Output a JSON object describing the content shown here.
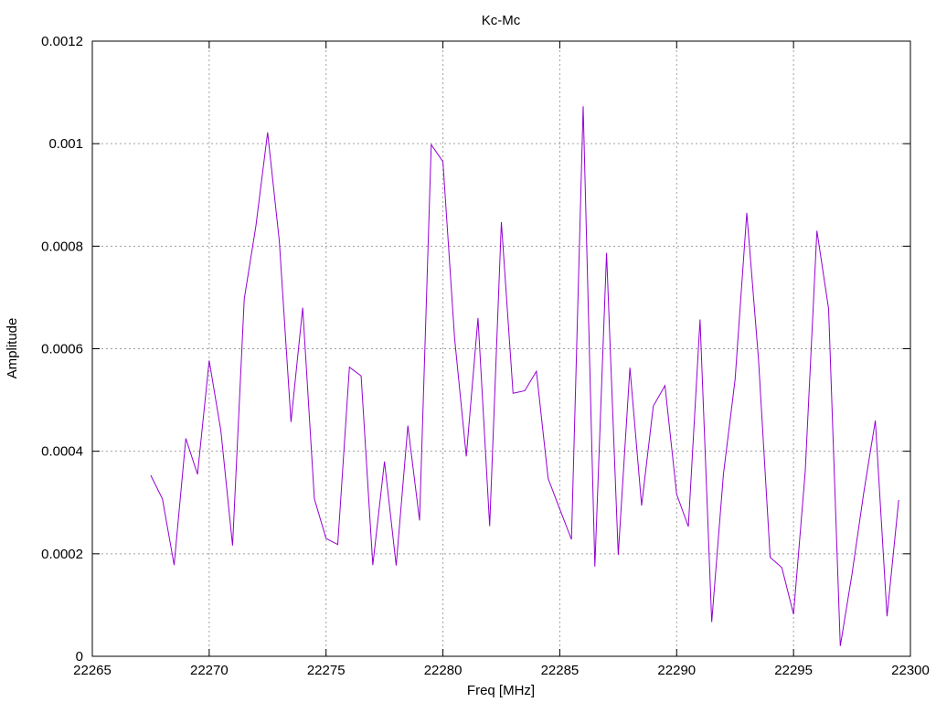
{
  "chart_data": {
    "type": "line",
    "title": "Kc-Mc",
    "xlabel": "Freq [MHz]",
    "ylabel": "Amplitude",
    "xlim": [
      22265,
      22300
    ],
    "ylim": [
      0,
      0.0012
    ],
    "x_ticks": [
      22265,
      22270,
      22275,
      22280,
      22285,
      22290,
      22295,
      22300
    ],
    "y_ticks": [
      "0",
      "0.0002",
      "0.0004",
      "0.0006",
      "0.0008",
      "0.001",
      "0.0012"
    ],
    "grid": true,
    "series_color": "#9400d3",
    "series": [
      {
        "x": [
          22267.5,
          22268.0,
          22268.5,
          22269.0,
          22269.5,
          22270.0,
          22270.5,
          22271.0,
          22271.5,
          22272.0,
          22272.5,
          22273.0,
          22273.5,
          22274.0,
          22274.5,
          22275.0,
          22275.5,
          22276.0,
          22276.5,
          22277.0,
          22277.5,
          22278.0,
          22278.5,
          22279.0,
          22279.5,
          22280.0,
          22280.5,
          22281.0,
          22281.5,
          22282.0,
          22282.5,
          22283.0,
          22283.5,
          22284.0,
          22284.5,
          22285.0,
          22285.5,
          22286.0,
          22286.5,
          22287.0,
          22287.5,
          22288.0,
          22288.5,
          22289.0,
          22289.5,
          22290.0,
          22290.5,
          22291.0,
          22291.5,
          22292.0,
          22292.5,
          22293.0,
          22293.5,
          22294.0,
          22294.5,
          22295.0,
          22295.5,
          22296.0,
          22296.5,
          22297.0,
          22297.5,
          22298.0,
          22298.5,
          22299.0,
          22299.5
        ],
        "values": [
          0.000353,
          0.000307,
          0.000178,
          0.000425,
          0.000355,
          0.000577,
          0.00044,
          0.000216,
          0.000697,
          0.00084,
          0.001022,
          0.00081,
          0.000457,
          0.00068,
          0.000307,
          0.00023,
          0.000218,
          0.000564,
          0.000547,
          0.000178,
          0.00038,
          0.000177,
          0.00045,
          0.000265,
          0.000998,
          0.000965,
          0.00062,
          0.00039,
          0.00066,
          0.000254,
          0.000847,
          0.000513,
          0.000518,
          0.000556,
          0.000347,
          0.000287,
          0.000228,
          0.001073,
          0.000175,
          0.000787,
          0.000198,
          0.000563,
          0.000294,
          0.000488,
          0.000528,
          0.000316,
          0.000253,
          0.000657,
          6.7e-05,
          0.000355,
          0.00054,
          0.000865,
          0.00058,
          0.000193,
          0.000173,
          8.2e-05,
          0.00036,
          0.00083,
          0.000678,
          2e-05,
          0.00016,
          0.000318,
          0.00046,
          7.8e-05,
          0.000305
        ]
      }
    ]
  }
}
